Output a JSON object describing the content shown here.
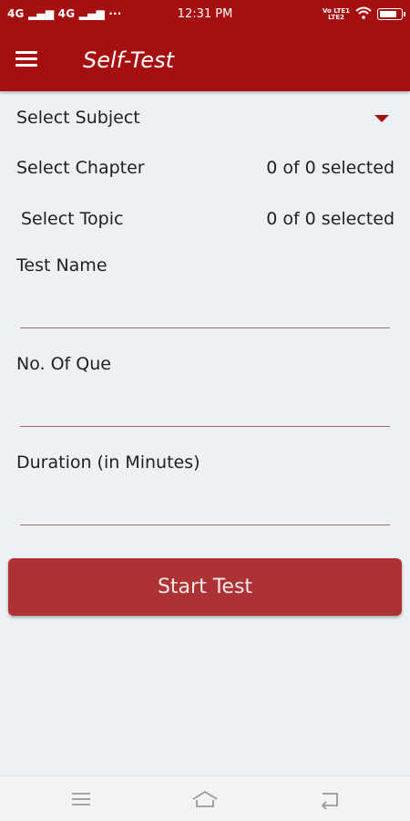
{
  "status_bar": {
    "left": "4G ▂▄▆ 4G ▂▄▆ ···",
    "time": "12:31 PM",
    "volte_line1": "Vo LTE1",
    "volte_line2": "LTE2",
    "battery_level": 0.8
  },
  "app_bar": {
    "title": "Self-Test"
  },
  "form": {
    "subject_label": "Select Subject",
    "chapter_label": "Select Chapter",
    "chapter_value": "0 of 0 selected",
    "topic_label": "Select Topic",
    "topic_value": "0 of 0 selected",
    "test_name_label": "Test Name",
    "test_name_value": "",
    "no_of_que_label": "No. Of Que",
    "no_of_que_value": "",
    "duration_label": "Duration (in Minutes)",
    "duration_value": ""
  },
  "start_button": {
    "label": "Start Test"
  },
  "icons": {
    "menu": "hamburger-menu-icon",
    "dropdown": "triangle-down-icon",
    "nav_menu": "menu-lines-icon",
    "nav_home": "home-icon",
    "nav_back": "back-arrow-icon"
  },
  "colors": {
    "primary": "#a50f10",
    "button": "#ad3236",
    "background": "#edf1f4",
    "underline": "#a56a6a"
  }
}
